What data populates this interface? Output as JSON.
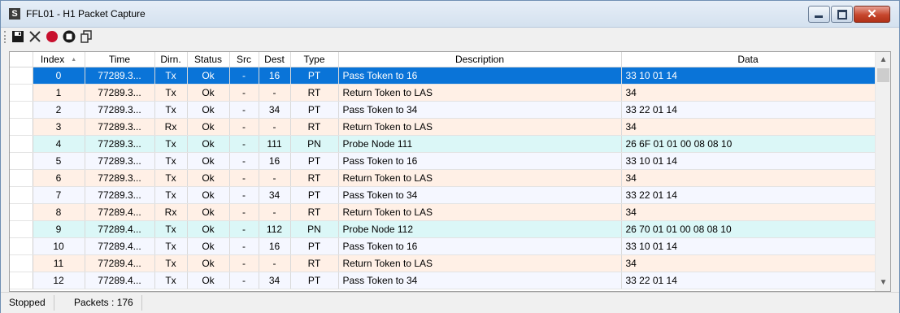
{
  "window": {
    "title": "FFL01 - H1 Packet Capture",
    "app_icon": "S",
    "close_glyph": "✕"
  },
  "toolbar": {
    "buttons": [
      {
        "name": "save-icon"
      },
      {
        "name": "delete-icon"
      },
      {
        "name": "record-icon"
      },
      {
        "name": "stop-icon"
      },
      {
        "name": "copy-icon"
      }
    ]
  },
  "colors": {
    "selected_row": "#0a74d8",
    "token_row": "#fff0e6",
    "pass_row": "#f5f7ff",
    "probe_row": "#dbf7f7",
    "record": "#c8102e"
  },
  "grid": {
    "columns": [
      "Index",
      "Time",
      "Dirn.",
      "Status",
      "Src",
      "Dest",
      "Type",
      "Description",
      "Data"
    ],
    "sort_indicator": "▲",
    "selected_index": 0,
    "rows": [
      {
        "index": "0",
        "time": "77289.3...",
        "dirn": "Tx",
        "status": "Ok",
        "src": "-",
        "dest": "16",
        "type": "PT",
        "description": "Pass Token to 16",
        "data": "33 10 01 14"
      },
      {
        "index": "1",
        "time": "77289.3...",
        "dirn": "Tx",
        "status": "Ok",
        "src": "-",
        "dest": "-",
        "type": "RT",
        "description": "Return Token to LAS",
        "data": "34"
      },
      {
        "index": "2",
        "time": "77289.3...",
        "dirn": "Tx",
        "status": "Ok",
        "src": "-",
        "dest": "34",
        "type": "PT",
        "description": "Pass Token to 34",
        "data": "33 22 01 14"
      },
      {
        "index": "3",
        "time": "77289.3...",
        "dirn": "Rx",
        "status": "Ok",
        "src": "-",
        "dest": "-",
        "type": "RT",
        "description": "Return Token to LAS",
        "data": "34"
      },
      {
        "index": "4",
        "time": "77289.3...",
        "dirn": "Tx",
        "status": "Ok",
        "src": "-",
        "dest": "111",
        "type": "PN",
        "description": "Probe Node 111",
        "data": "26 6F 01 01 00 08 08 10"
      },
      {
        "index": "5",
        "time": "77289.3...",
        "dirn": "Tx",
        "status": "Ok",
        "src": "-",
        "dest": "16",
        "type": "PT",
        "description": "Pass Token to 16",
        "data": "33 10 01 14"
      },
      {
        "index": "6",
        "time": "77289.3...",
        "dirn": "Tx",
        "status": "Ok",
        "src": "-",
        "dest": "-",
        "type": "RT",
        "description": "Return Token to LAS",
        "data": "34"
      },
      {
        "index": "7",
        "time": "77289.3...",
        "dirn": "Tx",
        "status": "Ok",
        "src": "-",
        "dest": "34",
        "type": "PT",
        "description": "Pass Token to 34",
        "data": "33 22 01 14"
      },
      {
        "index": "8",
        "time": "77289.4...",
        "dirn": "Rx",
        "status": "Ok",
        "src": "-",
        "dest": "-",
        "type": "RT",
        "description": "Return Token to LAS",
        "data": "34"
      },
      {
        "index": "9",
        "time": "77289.4...",
        "dirn": "Tx",
        "status": "Ok",
        "src": "-",
        "dest": "112",
        "type": "PN",
        "description": "Probe Node 112",
        "data": "26 70 01 01 00 08 08 10"
      },
      {
        "index": "10",
        "time": "77289.4...",
        "dirn": "Tx",
        "status": "Ok",
        "src": "-",
        "dest": "16",
        "type": "PT",
        "description": "Pass Token to 16",
        "data": "33 10 01 14"
      },
      {
        "index": "11",
        "time": "77289.4...",
        "dirn": "Tx",
        "status": "Ok",
        "src": "-",
        "dest": "-",
        "type": "RT",
        "description": "Return Token to LAS",
        "data": "34"
      },
      {
        "index": "12",
        "time": "77289.4...",
        "dirn": "Tx",
        "status": "Ok",
        "src": "-",
        "dest": "34",
        "type": "PT",
        "description": "Pass Token to 34",
        "data": "33 22 01 14"
      }
    ]
  },
  "statusbar": {
    "state": "Stopped",
    "packets": "Packets : 176"
  }
}
